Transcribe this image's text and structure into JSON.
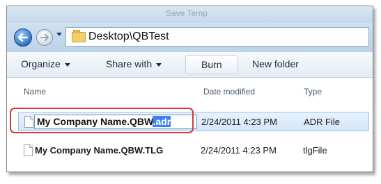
{
  "window": {
    "title_ghost": "Save Temp"
  },
  "address_bar": {
    "path_parts": [
      "Desktop",
      "QBTest"
    ],
    "path_text": "Desktop\\QBTest"
  },
  "toolbar": {
    "organize": "Organize",
    "share_with": "Share with",
    "burn": "Burn",
    "new_folder": "New folder"
  },
  "columns": {
    "name": "Name",
    "date_modified": "Date modified",
    "type": "Type"
  },
  "files": [
    {
      "name_base": "My Company Name.QBW",
      "name_selected_ext": ".adr",
      "date_modified": "2/24/2011 4:23 PM",
      "type": "ADR File",
      "renaming": true
    },
    {
      "name": "My Company Name.QBW.TLG",
      "date_modified": "2/24/2011 4:23 PM",
      "type": "tlgFile",
      "renaming": false
    }
  ],
  "colors": {
    "highlight_ring": "#d33b3b",
    "selection": "#3b82f0",
    "row_selected": "#d3e6fb"
  },
  "icons": [
    "back-arrow-icon",
    "forward-arrow-icon",
    "folder-icon",
    "file-icon",
    "chevron-down-icon"
  ]
}
